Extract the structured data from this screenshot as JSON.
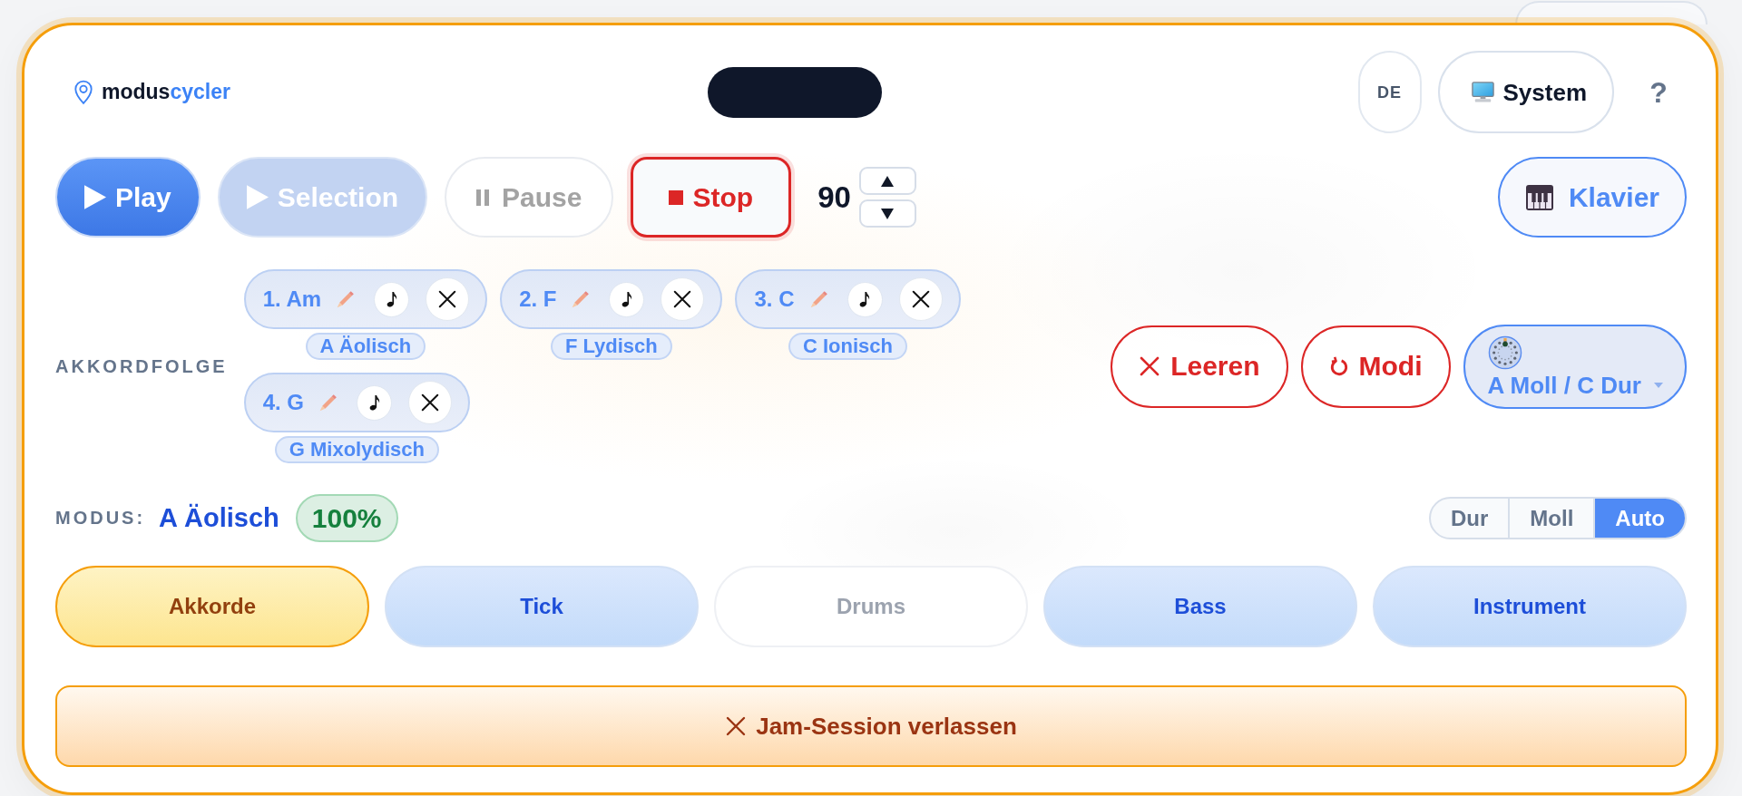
{
  "header": {
    "logo": {
      "part_1": "modus",
      "part_2": "cycler"
    },
    "language": "DE",
    "theme": "System",
    "help": "?"
  },
  "transport": {
    "buttons": [
      {
        "kind": "play",
        "label": "Play",
        "disabled": false,
        "active": false
      },
      {
        "kind": "play_selection",
        "label": "Selection",
        "disabled": true,
        "active": false
      },
      {
        "kind": "pause",
        "label": "Pause",
        "disabled": true,
        "active": false
      },
      {
        "kind": "stop",
        "label": "Stop",
        "disabled": false,
        "active": true
      }
    ],
    "tempo": "90",
    "instrument": "Klavier"
  },
  "progression": {
    "label": "AKKORDFOLGE",
    "chords": [
      {
        "name": "1. Am",
        "mode": "A Äolisch"
      },
      {
        "name": "2. F",
        "mode": "F Lydisch"
      },
      {
        "name": "3. C",
        "mode": "C Ionisch"
      },
      {
        "name": "4. G",
        "mode": "G Mixolydisch"
      }
    ],
    "actions": [
      {
        "kind": "clear",
        "label": "Leeren"
      },
      {
        "kind": "reset",
        "label": "Modi"
      }
    ],
    "key": "A Moll / C Dur"
  },
  "mode": {
    "label": "MODUS:",
    "value": "A Äolisch",
    "match": "100%",
    "scale_options": [
      {
        "label": "Dur",
        "selected": false
      },
      {
        "label": "Moll",
        "selected": false
      },
      {
        "label": "Auto",
        "selected": true
      }
    ]
  },
  "tracks": [
    {
      "label": "Akkorde",
      "selected": true,
      "on": true
    },
    {
      "label": "Tick",
      "selected": false,
      "on": true
    },
    {
      "label": "Drums",
      "selected": false,
      "on": false
    },
    {
      "label": "Bass",
      "selected": false,
      "on": true
    },
    {
      "label": "Instrument",
      "selected": false,
      "on": true
    }
  ],
  "leave_button": "Jam-Session verlassen"
}
